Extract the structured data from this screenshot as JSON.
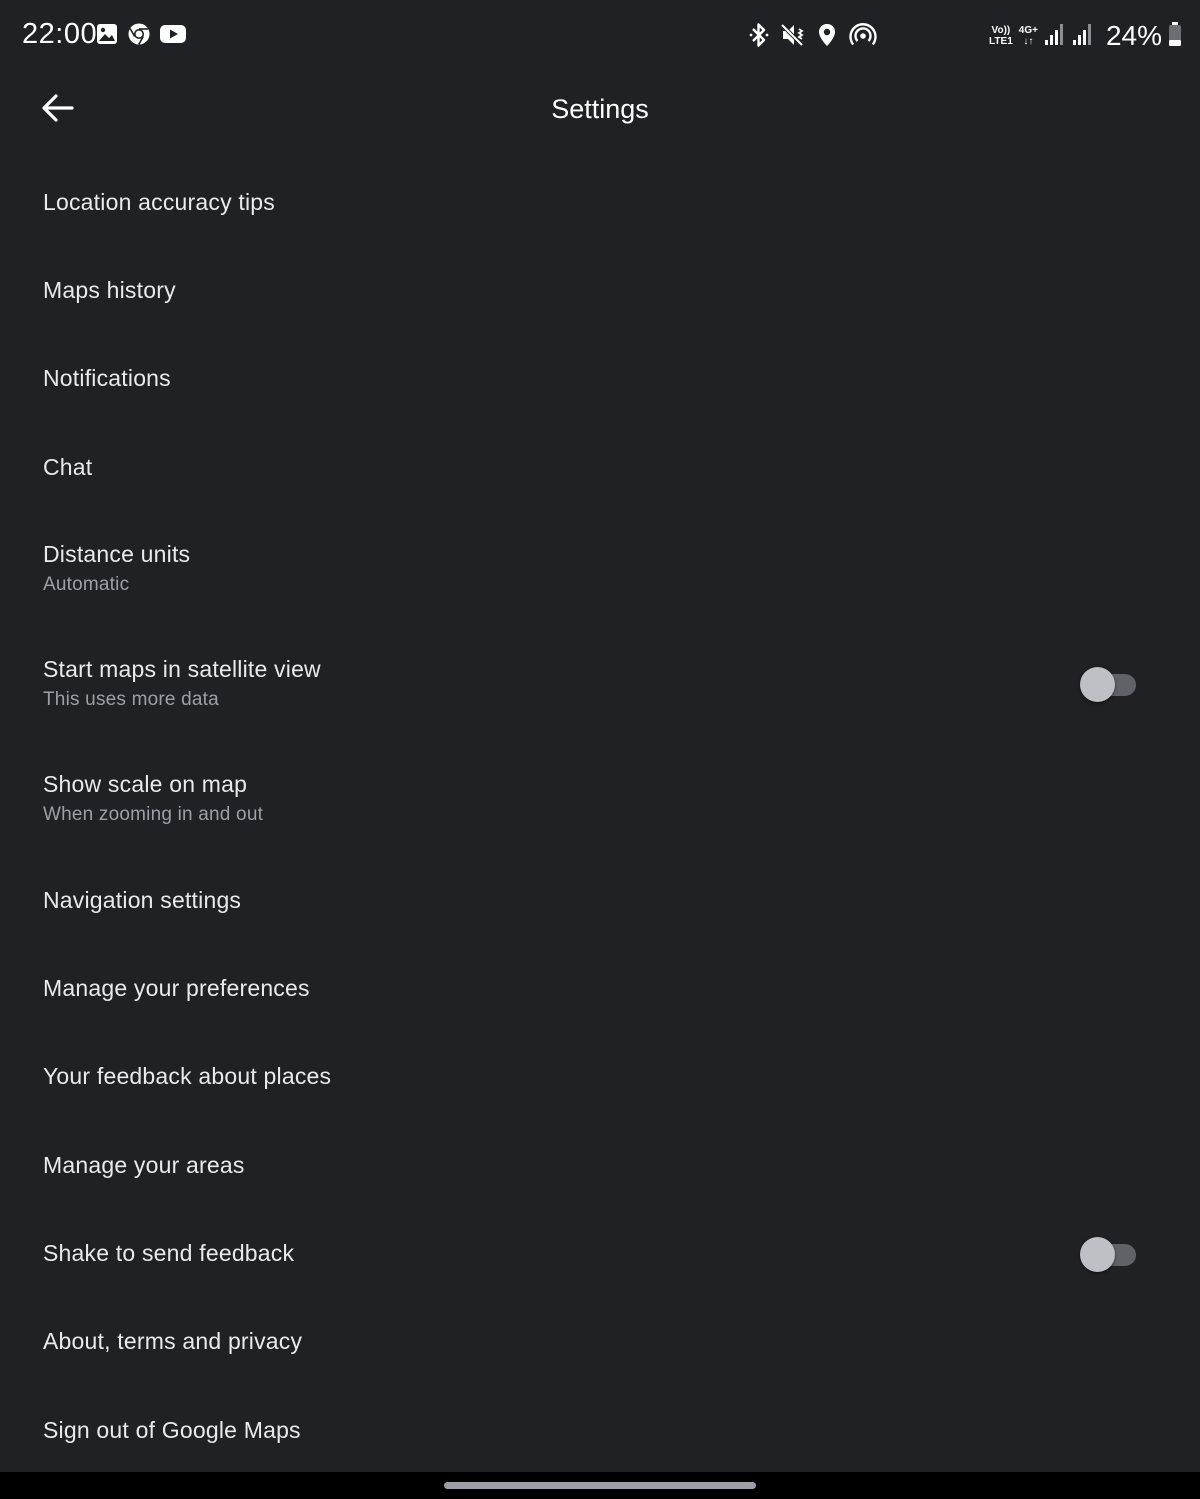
{
  "status_bar": {
    "time": "22:00",
    "left_icons": [
      "gallery-icon",
      "chrome-icon",
      "youtube-icon"
    ],
    "mid_icons": [
      "bluetooth-icon",
      "mute-vibrate-icon",
      "location-icon",
      "hotspot-icon"
    ],
    "network_labels": {
      "volte_top": "Vo))",
      "volte_bottom": "LTE1",
      "data_top": "4G+",
      "data_bottom": "↓↑"
    },
    "battery": "24%"
  },
  "app_bar": {
    "title": "Settings",
    "back_icon": "arrow-back-icon"
  },
  "settings": {
    "items": [
      {
        "label": "Location accuracy tips"
      },
      {
        "label": "Maps history"
      },
      {
        "label": "Notifications"
      },
      {
        "label": "Chat"
      },
      {
        "label": "Distance units",
        "subtitle": "Automatic"
      },
      {
        "label": "Start maps in satellite view",
        "subtitle": "This uses more data",
        "toggle": false
      },
      {
        "label": "Show scale on map",
        "subtitle": "When zooming in and out"
      },
      {
        "label": "Navigation settings"
      },
      {
        "label": "Manage your preferences"
      },
      {
        "label": "Your feedback about places"
      },
      {
        "label": "Manage your areas"
      },
      {
        "label": "Shake to send feedback",
        "toggle": false
      },
      {
        "label": "About, terms and privacy"
      },
      {
        "label": "Sign out of Google Maps"
      }
    ]
  },
  "colors": {
    "background": "#202124",
    "text_primary": "#e8eaed",
    "text_secondary": "#9aa0a6",
    "toggle_track_off": "#5f6368",
    "toggle_thumb_off": "#bdc1c6"
  }
}
